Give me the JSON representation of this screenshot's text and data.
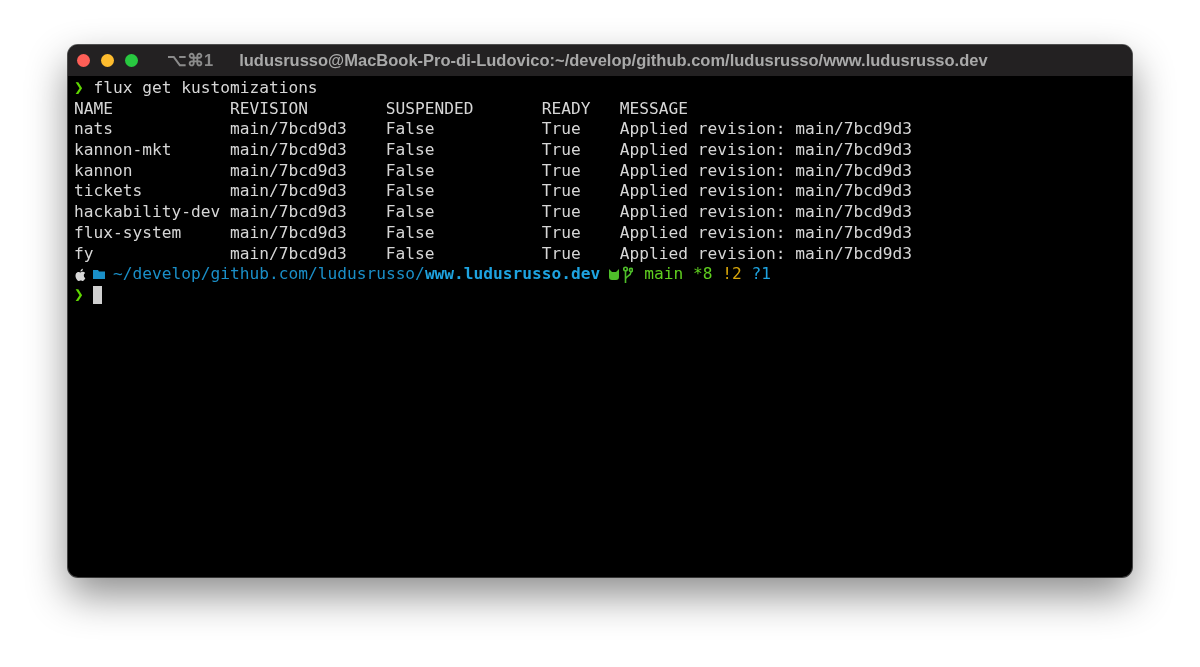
{
  "window": {
    "shortcut": "⌥⌘1",
    "title": "ludusrusso@MacBook-Pro-di-Ludovico:~/develop/github.com/ludusrusso/www.ludusrusso.dev"
  },
  "command": {
    "prompt": "❯",
    "text": "flux get kustomizations"
  },
  "table": {
    "columns": [
      "NAME",
      "REVISION",
      "SUSPENDED",
      "READY",
      "MESSAGE"
    ],
    "rows": [
      [
        "nats",
        "main/7bcd9d3",
        "False",
        "True",
        "Applied revision: main/7bcd9d3"
      ],
      [
        "kannon-mkt",
        "main/7bcd9d3",
        "False",
        "True",
        "Applied revision: main/7bcd9d3"
      ],
      [
        "kannon",
        "main/7bcd9d3",
        "False",
        "True",
        "Applied revision: main/7bcd9d3"
      ],
      [
        "tickets",
        "main/7bcd9d3",
        "False",
        "True",
        "Applied revision: main/7bcd9d3"
      ],
      [
        "hackability-dev",
        "main/7bcd9d3",
        "False",
        "True",
        "Applied revision: main/7bcd9d3"
      ],
      [
        "flux-system",
        "main/7bcd9d3",
        "False",
        "True",
        "Applied revision: main/7bcd9d3"
      ],
      [
        "fy",
        "main/7bcd9d3",
        "False",
        "True",
        "Applied revision: main/7bcd9d3"
      ]
    ]
  },
  "status": {
    "path": "~/develop/github.com/ludusrusso/",
    "dir": "www.ludusrusso.dev",
    "branch": "main",
    "counts": [
      {
        "text": "*8",
        "color": "#5fcf1f"
      },
      {
        "text": "!2",
        "color": "#d7a50a"
      },
      {
        "text": "?1",
        "color": "#1ea3e0"
      }
    ]
  },
  "input": {
    "prompt": "❯"
  }
}
